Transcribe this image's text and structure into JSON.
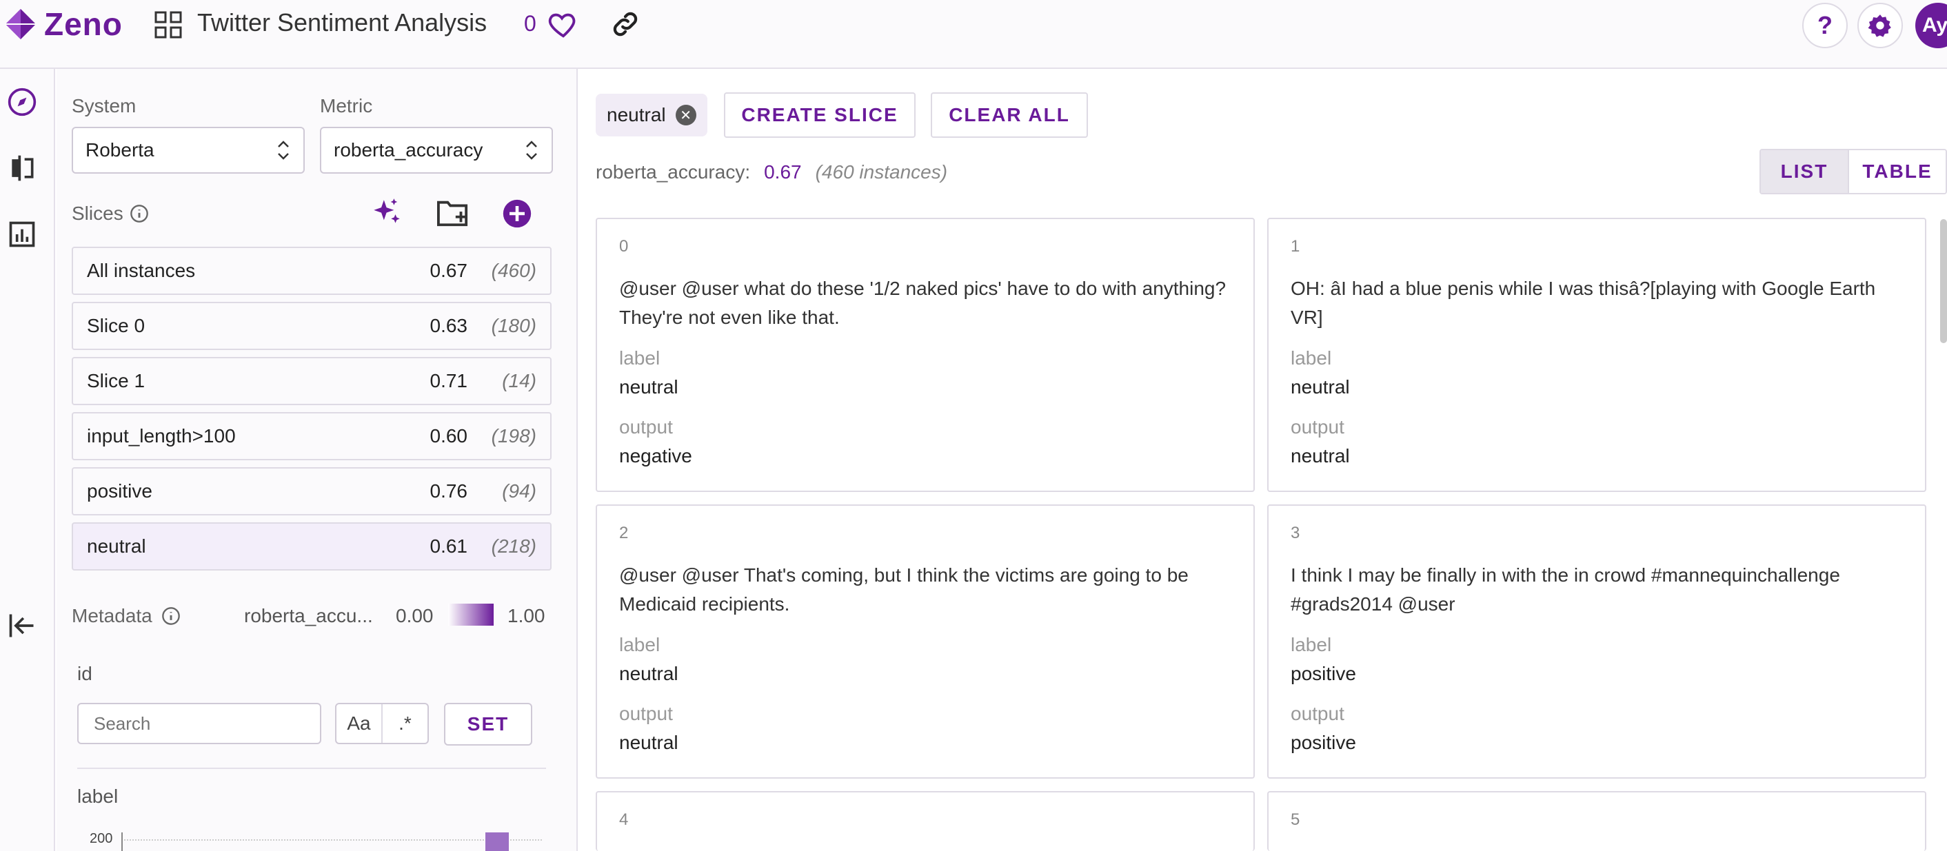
{
  "header": {
    "brand": "Zeno",
    "project_title": "Twitter Sentiment Analysis",
    "like_count": "0",
    "help_label": "?",
    "user_initials": "Ay"
  },
  "sidebar": {
    "system_label": "System",
    "system_value": "Roberta",
    "metric_label": "Metric",
    "metric_value": "roberta_accuracy",
    "slices_label": "Slices",
    "slices": [
      {
        "name": "All instances",
        "value": "0.67",
        "count": "(460)"
      },
      {
        "name": "Slice 0",
        "value": "0.63",
        "count": "(180)"
      },
      {
        "name": "Slice 1",
        "value": "0.71",
        "count": "(14)"
      },
      {
        "name": "input_length>100",
        "value": "0.60",
        "count": "(198)"
      },
      {
        "name": "positive",
        "value": "0.76",
        "count": "(94)"
      },
      {
        "name": "neutral",
        "value": "0.61",
        "count": "(218)"
      }
    ],
    "metadata_label": "Metadata",
    "metadata_metric": "roberta_accu...",
    "scale_min": "0.00",
    "scale_max": "1.00",
    "id_label": "id",
    "search_placeholder": "Search",
    "case_toggle": "Aa",
    "regex_toggle": ".*",
    "set_label": "SET",
    "label_label": "label",
    "chart_tick": "200"
  },
  "main": {
    "filter_chip": "neutral",
    "create_slice_label": "CREATE SLICE",
    "clear_all_label": "CLEAR ALL",
    "metric_name": "roberta_accuracy:",
    "metric_value": "0.67",
    "metric_count": "(460 instances)",
    "view_list": "LIST",
    "view_table": "TABLE",
    "field_label": "label",
    "field_output": "output",
    "cards": [
      {
        "index": "0",
        "text": "@user @user what do these '1/2 naked pics' have to do with anything? They're not even like that.",
        "label": "neutral",
        "output": "negative"
      },
      {
        "index": "1",
        "text": "OH: âI had a blue penis while I was thisâ?[playing with Google Earth VR]",
        "label": "neutral",
        "output": "neutral"
      },
      {
        "index": "2",
        "text": "@user @user That's coming, but I think the victims are going to be Medicaid recipients.",
        "label": "neutral",
        "output": "neutral"
      },
      {
        "index": "3",
        "text": "I think I may be finally in with the in crowd #mannequinchallenge #grads2014 @user",
        "label": "positive",
        "output": "positive"
      },
      {
        "index": "4"
      },
      {
        "index": "5"
      }
    ]
  },
  "colors": {
    "accent": "#6a1b9a",
    "active_slice_bg": "#f3eefa"
  }
}
